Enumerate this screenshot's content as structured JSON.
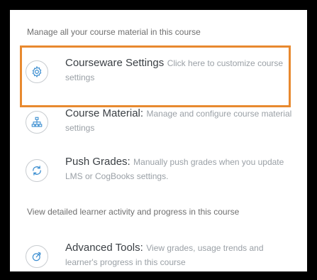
{
  "sections": [
    {
      "caption": "Manage all your course material in this course"
    },
    {
      "caption": "View detailed learner activity and progress in this course"
    }
  ],
  "items": [
    {
      "title": "Courseware Settings",
      "description": "Click here to customize course settings",
      "icon": "gear-icon"
    },
    {
      "title": "Course Material:",
      "description": "Manage and configure course material settings",
      "icon": "hierarchy-icon"
    },
    {
      "title": "Push Grades:",
      "description": "Manually push grades when you update LMS or CogBooks settings.",
      "icon": "refresh-icon"
    },
    {
      "title": "Advanced Tools:",
      "description": "View grades, usage trends and learner's progress in this course",
      "icon": "analytics-icon"
    }
  ],
  "colors": {
    "highlight_border": "#e8892f",
    "icon_stroke": "#3d8fd1",
    "title_text": "#3a3f44",
    "desc_text": "#9aa0a6"
  }
}
